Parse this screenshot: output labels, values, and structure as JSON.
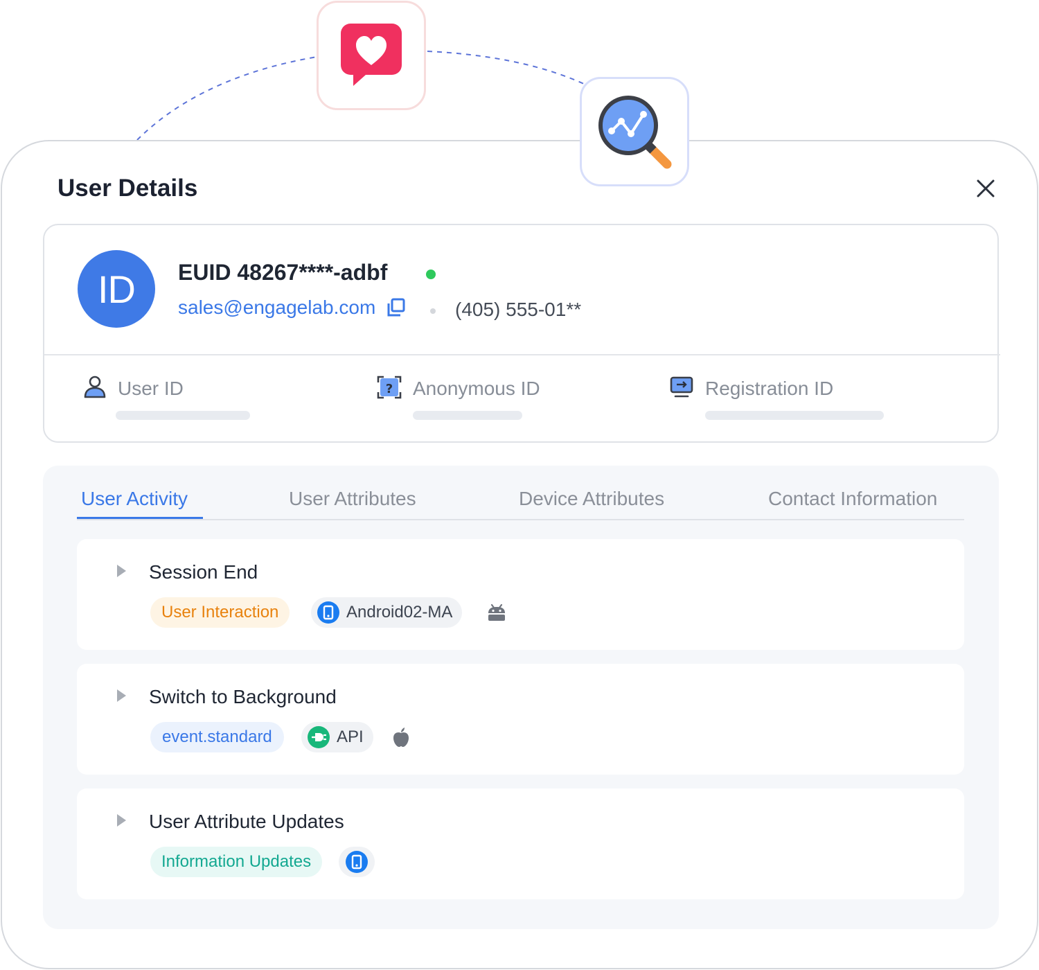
{
  "panel": {
    "title": "User Details"
  },
  "profile": {
    "avatar_text": "ID",
    "euid": "EUID 48267****-adbf",
    "status_color": "#2ec95c",
    "email": "sales@engagelab.com",
    "phone": "(405) 555-01**"
  },
  "identifiers": [
    {
      "label": "User ID",
      "icon": "user-icon"
    },
    {
      "label": "Anonymous ID",
      "icon": "anonymous-id-icon"
    },
    {
      "label": "Registration ID",
      "icon": "registration-id-icon"
    }
  ],
  "tabs": [
    {
      "label": "User Activity",
      "active": true
    },
    {
      "label": "User Attributes",
      "active": false
    },
    {
      "label": "Device Attributes",
      "active": false
    },
    {
      "label": "Contact Information",
      "active": false
    }
  ],
  "events": [
    {
      "title": "Session End",
      "tag": "User Interaction",
      "tag_color": "#e8820e",
      "device_label": "Android02-MA",
      "device_icon": "mobile-device-icon",
      "platform_icon": "android-icon"
    },
    {
      "title": "Switch to Background",
      "tag": "event.standard",
      "tag_color": "#3a78e7",
      "device_label": "API",
      "device_icon": "api-plug-icon",
      "platform_icon": "apple-icon"
    },
    {
      "title": "User Attribute Updates",
      "tag": "Information Updates",
      "tag_color": "#13a891",
      "device_icon": "mobile-device-icon"
    }
  ],
  "colors": {
    "accent": "#3a78e7",
    "heart_tile": "#f0305f",
    "search_tile": "#6e9ff4",
    "magnifier_handle": "#f4973f"
  }
}
